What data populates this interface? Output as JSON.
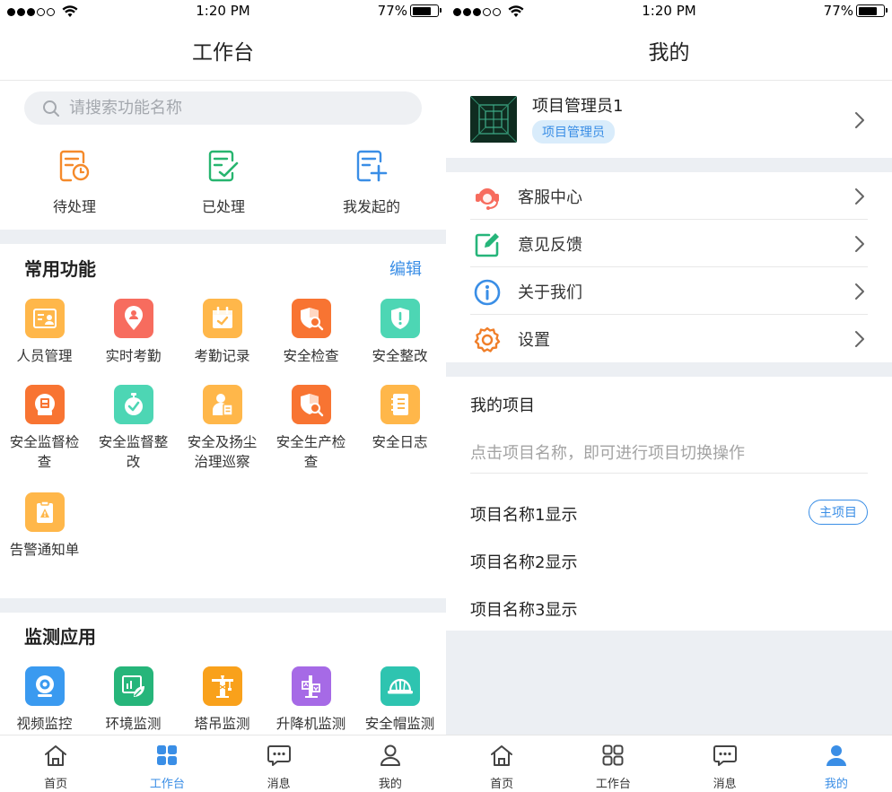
{
  "status": {
    "time": "1:20 PM",
    "battery": "77%",
    "battery_level": 0.77
  },
  "workbench": {
    "title": "工作台",
    "search": {
      "placeholder": "请搜索功能名称"
    },
    "quick": [
      {
        "label": "待处理",
        "icon": "pending-doc-icon"
      },
      {
        "label": "已处理",
        "icon": "done-doc-icon"
      },
      {
        "label": "我发起的",
        "icon": "initiated-doc-icon"
      }
    ],
    "common": {
      "title": "常用功能",
      "edit": "编辑",
      "items": [
        {
          "label": "人员管理",
          "icon": "personnel-card-icon",
          "color": "#ffb74a"
        },
        {
          "label": "实时考勤",
          "icon": "location-person-icon",
          "color": "#f76c5e"
        },
        {
          "label": "考勤记录",
          "icon": "calendar-check-icon",
          "color": "#ffb74a"
        },
        {
          "label": "安全检查",
          "icon": "shield-search-icon",
          "color": "#f87432"
        },
        {
          "label": "安全整改",
          "icon": "shield-alert-icon",
          "color": "#4dd6b4"
        },
        {
          "label": "安全监督检查",
          "icon": "badge-monitor-icon",
          "color": "#f87432"
        },
        {
          "label": "安全监督整改",
          "icon": "stopwatch-check-icon",
          "color": "#4dd6b4"
        },
        {
          "label": "安全及扬尘治理巡察",
          "icon": "inspector-icon",
          "color": "#ffb74a"
        },
        {
          "label": "安全生产检查",
          "icon": "shield-search-icon",
          "color": "#f87432"
        },
        {
          "label": "安全日志",
          "icon": "notebook-icon",
          "color": "#ffb74a"
        },
        {
          "label": "告警通知单",
          "icon": "alert-clipboard-icon",
          "color": "#ffb74a"
        }
      ]
    },
    "monitor": {
      "title": "监测应用",
      "items": [
        {
          "label": "视频监控",
          "icon": "webcam-icon",
          "color": "#3a9af0"
        },
        {
          "label": "环境监测",
          "icon": "leaf-chart-icon",
          "color": "#26b57a"
        },
        {
          "label": "塔吊监测",
          "icon": "tower-crane-icon",
          "color": "#f9a11b"
        },
        {
          "label": "升降机监测",
          "icon": "elevator-icon",
          "color": "#a66ae6"
        },
        {
          "label": "安全帽监测",
          "icon": "helmet-icon",
          "color": "#2ec4b0"
        }
      ]
    }
  },
  "mine": {
    "title": "我的",
    "profile": {
      "name": "项目管理员1",
      "role": "项目管理员"
    },
    "menu": [
      {
        "label": "客服中心",
        "icon": "customer-service-icon",
        "color": "#f76c5e"
      },
      {
        "label": "意见反馈",
        "icon": "feedback-edit-icon",
        "color": "#26b57a"
      },
      {
        "label": "关于我们",
        "icon": "info-icon",
        "color": "#3a8ee6"
      },
      {
        "label": "设置",
        "icon": "settings-gear-icon",
        "color": "#f07f2a"
      }
    ],
    "projects": {
      "title": "我的项目",
      "hint": "点击项目名称，即可进行项目切换操作",
      "items": [
        "项目名称1显示",
        "项目名称2显示",
        "项目名称3显示"
      ],
      "main_badge": "主项目"
    }
  },
  "tabs": [
    {
      "label": "首页",
      "icon": "home-icon"
    },
    {
      "label": "工作台",
      "icon": "grid-icon"
    },
    {
      "label": "消息",
      "icon": "message-icon"
    },
    {
      "label": "我的",
      "icon": "person-icon"
    }
  ],
  "colors": {
    "accent": "#3a8ee6",
    "band": "#eceff3"
  }
}
